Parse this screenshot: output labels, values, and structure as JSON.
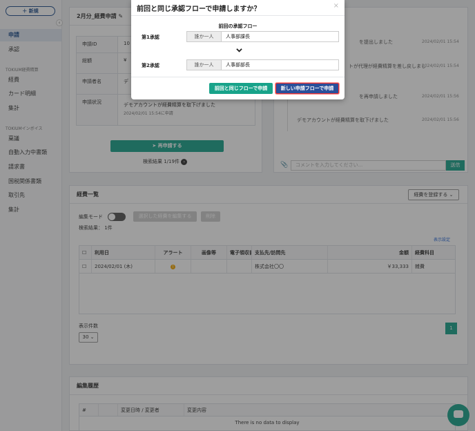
{
  "sidebar": {
    "new_label": "＋ 新規",
    "collapse_icon": "‹",
    "items": [
      {
        "label": "申請",
        "active": true
      },
      {
        "label": "承認"
      },
      {
        "section": "TOKIUM経費精算"
      },
      {
        "label": "経費"
      },
      {
        "label": "カード明細"
      },
      {
        "label": "集計"
      },
      {
        "section": "TOKIUMインボイス"
      },
      {
        "label": "稟議"
      },
      {
        "label": "自動入力中書類"
      },
      {
        "label": "請求書"
      },
      {
        "label": "国税関係書類"
      },
      {
        "label": "取引先"
      },
      {
        "label": "集計"
      }
    ]
  },
  "report": {
    "title": "2月分_経費申請",
    "rows": [
      {
        "label": "申請ID",
        "value": "10"
      },
      {
        "label": "総額",
        "value": "¥"
      },
      {
        "label": "申請者名",
        "value": "デ"
      },
      {
        "label": "申請状況",
        "value": ""
      }
    ],
    "status_text": "デモアカウントが経費精算を取下げました",
    "status_time": "2024/02/01 15:54に申請",
    "resubmit_label": "再申請する",
    "search_result": "検索結果 1/19件"
  },
  "history": {
    "items": [
      {
        "text": "を提出しました",
        "date": "2024/02/01 15:54"
      },
      {
        "text": "トが代理が経費精算を差し戻しまし",
        "date": "2024/02/01 15:54"
      },
      {
        "text": "を再申請しました",
        "date": "2024/02/01 15:56"
      },
      {
        "text": "デモアカウントが経費精算を取下げました",
        "date": "2024/02/01 15:56"
      }
    ],
    "comment_placeholder": "コメントを入力してください...",
    "send_label": "送信"
  },
  "expenses": {
    "title": "経費一覧",
    "register_label": "経費を登録する",
    "edit_mode_label": "編集モード",
    "bulk_edit_label": "選択した経費を編集する",
    "delete_label": "削除",
    "search_result": "検索結果： 1件",
    "display_settings": "表示設定",
    "columns": [
      "",
      "利用日",
      "アラート",
      "画像等",
      "電子領収書",
      "支払先/訪問先",
      "金額",
      "経費科目"
    ],
    "row": {
      "date": "2024/02/01 (木)",
      "alert": "!",
      "payee": "株式会社〇〇",
      "amount": "￥33,333",
      "category": "雑費"
    },
    "page_size_label": "表示件数",
    "page_size_value": "30",
    "current_page": "1"
  },
  "edit_history": {
    "title": "編集履歴",
    "columns": [
      "#",
      "",
      "変更日時 / 変更者",
      "変更内容"
    ],
    "empty_text": "There is no data to display"
  },
  "modal": {
    "title": "前回と同じ承認フローで申請しますか？",
    "close": "×",
    "flow_label": "前回の承認フロー",
    "steps": [
      {
        "label": "第1承認",
        "type": "誰か一人",
        "name": "人事部課長"
      },
      {
        "label": "第2承認",
        "type": "誰か一人",
        "name": "人事部部長"
      }
    ],
    "same_flow_label": "前回と同じフローで申請",
    "new_flow_label": "新しい申請フローで申請"
  }
}
